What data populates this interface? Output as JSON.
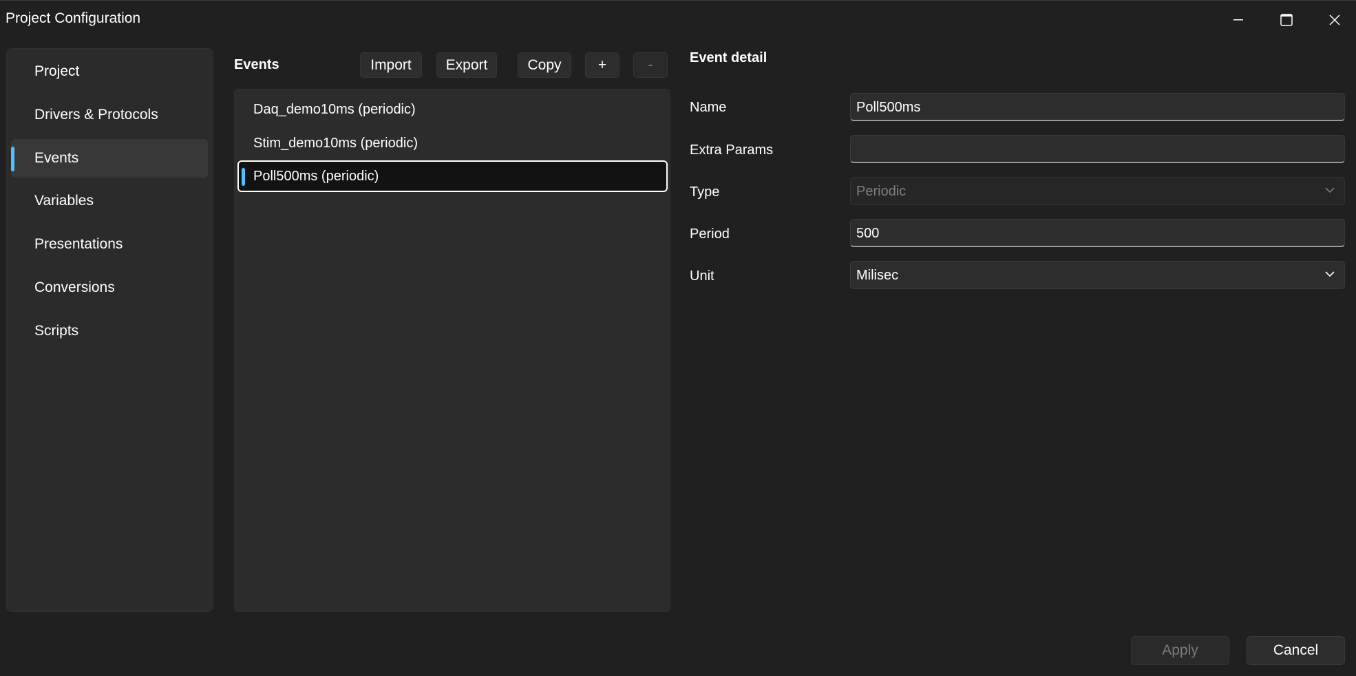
{
  "window": {
    "title": "Project Configuration",
    "controls": {
      "minimize": "minimize-icon",
      "maximize": "maximize-icon",
      "close": "close-icon"
    }
  },
  "sidebar": {
    "items": [
      {
        "label": "Project",
        "selected": false
      },
      {
        "label": "Drivers & Protocols",
        "selected": false
      },
      {
        "label": "Events",
        "selected": true
      },
      {
        "label": "Variables",
        "selected": false
      },
      {
        "label": "Presentations",
        "selected": false
      },
      {
        "label": "Conversions",
        "selected": false
      },
      {
        "label": "Scripts",
        "selected": false
      }
    ]
  },
  "events": {
    "header": "Events",
    "toolbar": {
      "import_label": "Import",
      "export_label": "Export",
      "copy_label": "Copy",
      "add_label": "+",
      "remove_label": "-"
    },
    "items": [
      {
        "label": "Daq_demo10ms (periodic)",
        "selected": false
      },
      {
        "label": "Stim_demo10ms (periodic)",
        "selected": false
      },
      {
        "label": "Poll500ms (periodic)",
        "selected": true
      }
    ]
  },
  "detail": {
    "header": "Event detail",
    "fields": {
      "name": {
        "label": "Name",
        "value": "Poll500ms"
      },
      "extra_params": {
        "label": "Extra Params",
        "value": ""
      },
      "type": {
        "label": "Type",
        "value": "Periodic",
        "disabled": true
      },
      "period": {
        "label": "Period",
        "value": "500"
      },
      "unit": {
        "label": "Unit",
        "value": "Milisec"
      }
    }
  },
  "footer": {
    "apply_label": "Apply",
    "cancel_label": "Cancel"
  },
  "colors": {
    "accent": "#4cc2ff",
    "background": "#202020",
    "panel": "#2b2b2b"
  }
}
